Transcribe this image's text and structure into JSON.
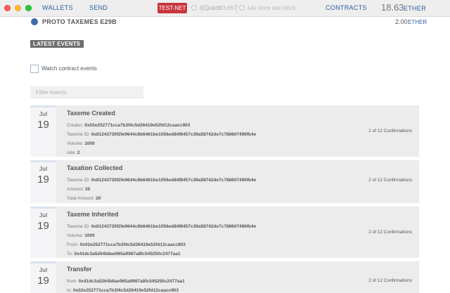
{
  "topbar": {
    "wallets": "WALLETS",
    "send": "SEND",
    "network": "TEST-NET",
    "peers": "10 peers",
    "block": "1,333,667",
    "last_block": "14s since last block",
    "contracts": "CONTRACTS",
    "balance": "18.63",
    "balance_unit": "ETHER"
  },
  "contract": {
    "name": "PROTO TAXEMES E29B",
    "balance": "2.00",
    "balance_unit": "ETHER"
  },
  "events_section": {
    "title": "LATEST EVENTS",
    "watch_label": "Watch contract events",
    "filter_placeholder": "Filter events"
  },
  "events": [
    {
      "month": "Jul",
      "day": "19",
      "title": "Taxeme Created",
      "confirmations": "2 of 12 Confirmations",
      "lines": [
        {
          "key": "Creator:",
          "value": "0x02e252771cca7b3f4c5d26419e52fd12caacc903"
        },
        {
          "key": "Taxeme ID:",
          "value": "0x81243730f2fe9644c8b6461be1056ed84f8457c39a58742de7c788607496fb4e"
        },
        {
          "key": "Volume:",
          "value": "1000"
        },
        {
          "key": "rate:",
          "value": "2"
        }
      ]
    },
    {
      "month": "Jul",
      "day": "19",
      "title": "Taxation Collected",
      "confirmations": "2 of 12 Confirmations",
      "lines": [
        {
          "key": "Taxeme ID:",
          "value": "0x81243730f2fe9644c8b6461be1056ed84f8457c39a58742de7c788607496fb4e"
        },
        {
          "key": "Amount:",
          "value": "20"
        },
        {
          "key": "Total Amount:",
          "value": "20"
        }
      ]
    },
    {
      "month": "Jul",
      "day": "19",
      "title": "Taxeme Inherited",
      "confirmations": "2 of 12 Confirmations",
      "lines": [
        {
          "key": "Taxeme ID:",
          "value": "0x81243730f2fe9644c8b6461be1056ed84f8457c39a58742de7c788607496fb4e"
        },
        {
          "key": "Volume:",
          "value": "1000"
        },
        {
          "key": "From:",
          "value": "0x02e252771cca7b3f4c5d26419e52fd12caacc903"
        },
        {
          "key": "To:",
          "value": "0x41dc3a5264b8ae965a9987a8fc545250c2477aa1"
        }
      ]
    },
    {
      "month": "Jul",
      "day": "19",
      "title": "Transfer",
      "confirmations": "2 of 12 Confirmations",
      "lines": [
        {
          "key": "from:",
          "value": "0x41dc3a5264b8ae965a9987a8fc545250c2477aa1"
        },
        {
          "key": "to:",
          "value": "0x02e252771cca7b3f4c5d26419e52fd12caacc903"
        }
      ]
    }
  ]
}
